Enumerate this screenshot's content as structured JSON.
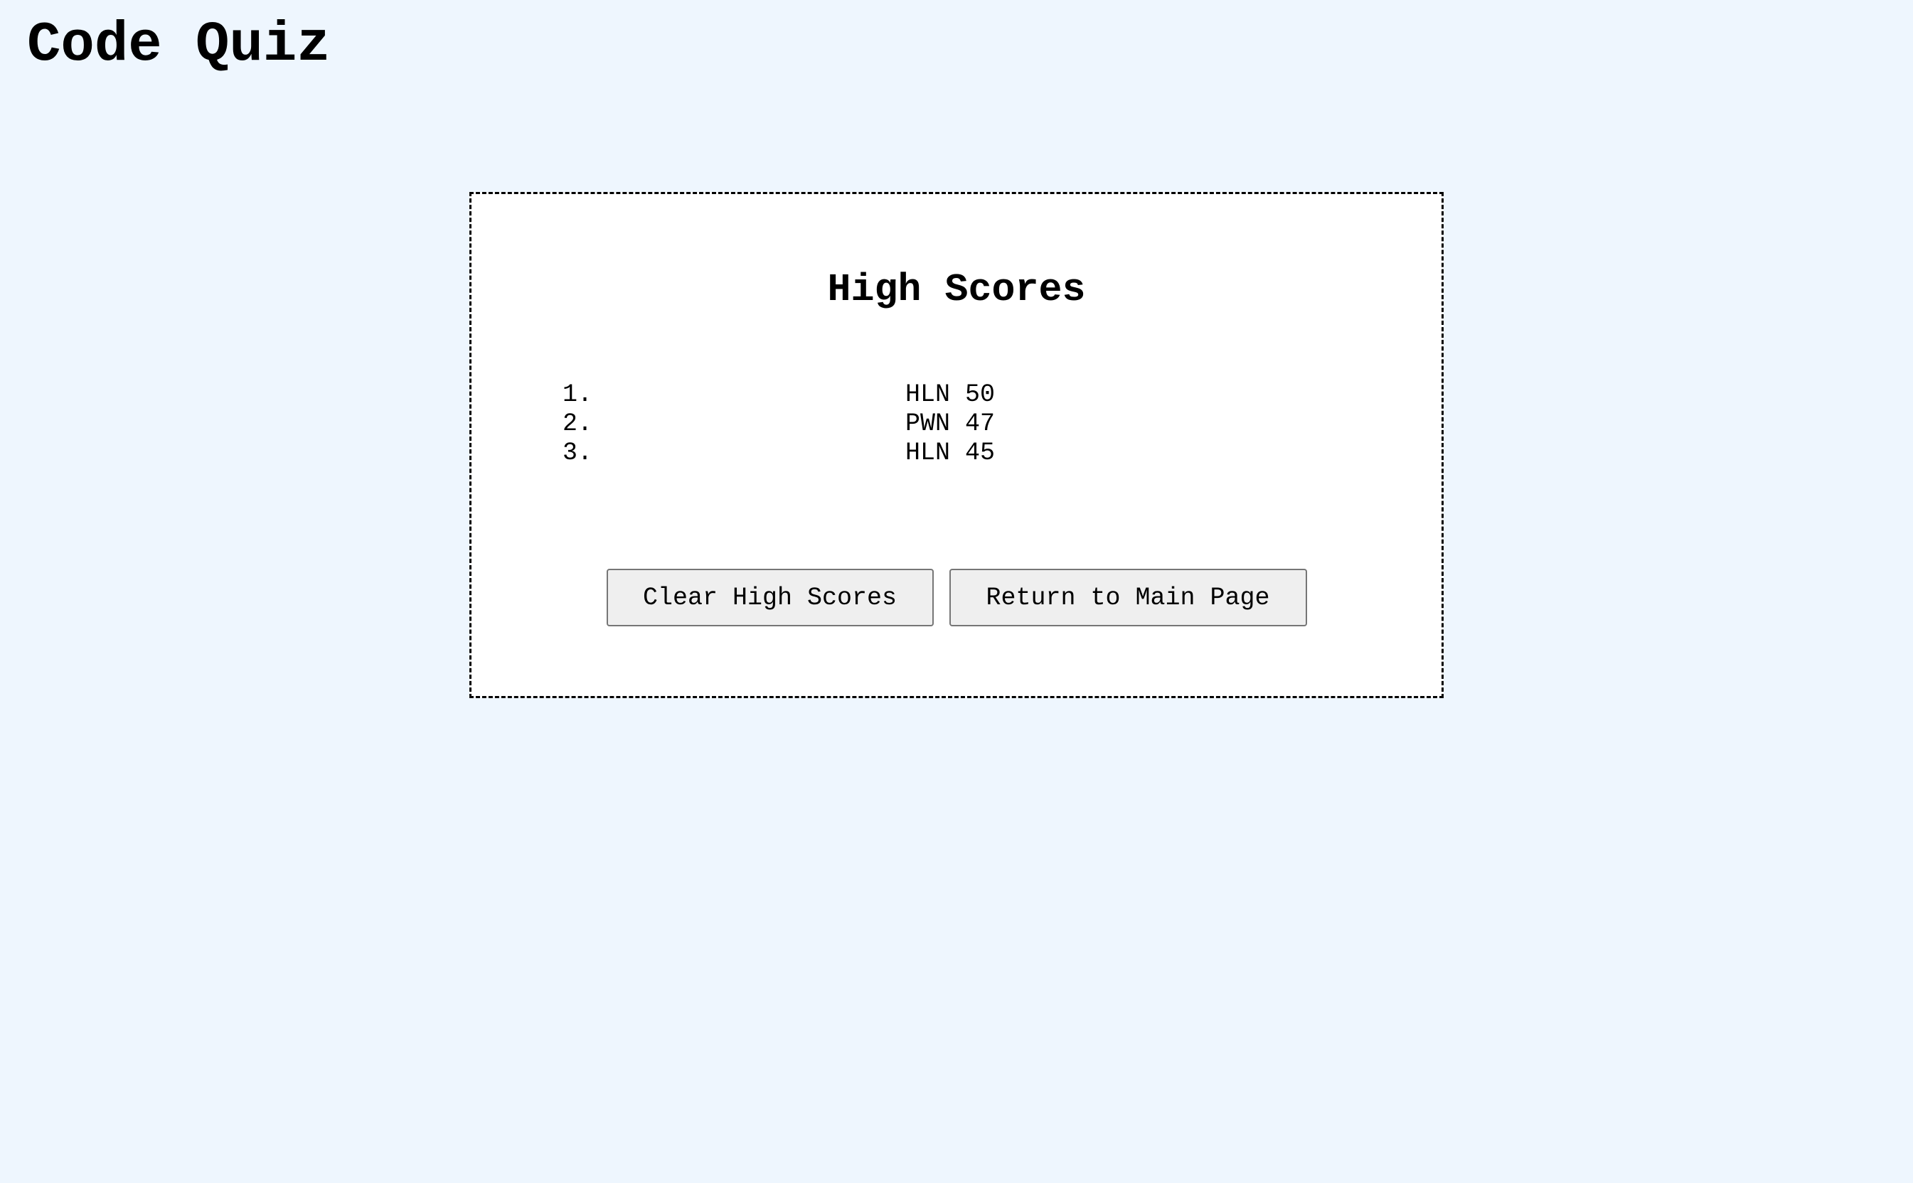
{
  "header": {
    "title": "Code Quiz"
  },
  "high_scores": {
    "heading": "High Scores",
    "entries": [
      {
        "rank": "1.",
        "text": "HLN 50"
      },
      {
        "rank": "2.",
        "text": "PWN 47"
      },
      {
        "rank": "3.",
        "text": "HLN 45"
      }
    ]
  },
  "buttons": {
    "clear_label": "Clear High Scores",
    "return_label": "Return to Main Page"
  },
  "colors": {
    "page_background": "#eef6fe",
    "card_background": "#ffffff",
    "button_background": "#efefef"
  }
}
